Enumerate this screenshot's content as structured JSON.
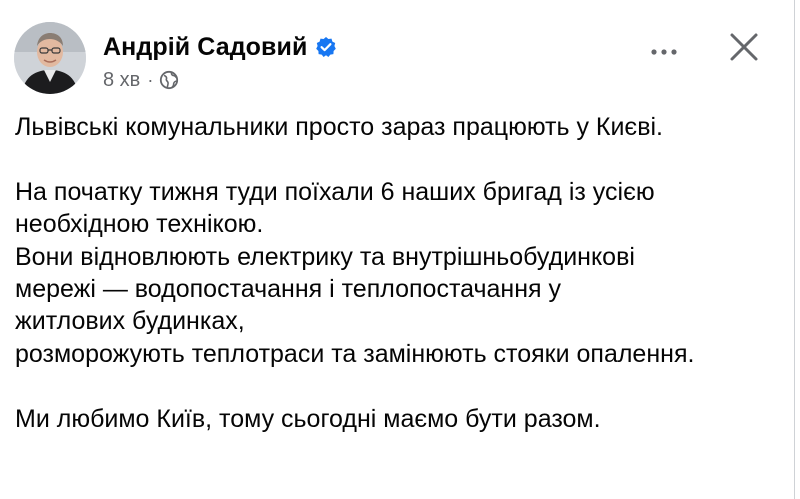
{
  "author": {
    "name": "Андрій Садовий",
    "verified": true,
    "avatar_icon": "profile-photo"
  },
  "meta": {
    "time": "8 хв",
    "separator": "·",
    "audience_icon": "globe-icon"
  },
  "actions": {
    "more_icon": "more-horizontal-icon",
    "close_icon": "close-icon"
  },
  "post": {
    "paragraphs": [
      "Львівські комунальники просто зараз працюють у Києві.",
      "На початку тижня туди поїхали 6 наших бригад із усією необхідною технікою.",
      "Вони відновлюють електрику та внутрішньобудинкові мережі — водопостачання і теплопостачання у житлових будинках,",
      "розморожують теплотраси та замінюють стояки опалення.",
      "Ми любимо Київ, тому сьогодні маємо бути разом."
    ]
  },
  "colors": {
    "text": "#050505",
    "secondary": "#65676b",
    "verified_blue": "#1877f2"
  }
}
